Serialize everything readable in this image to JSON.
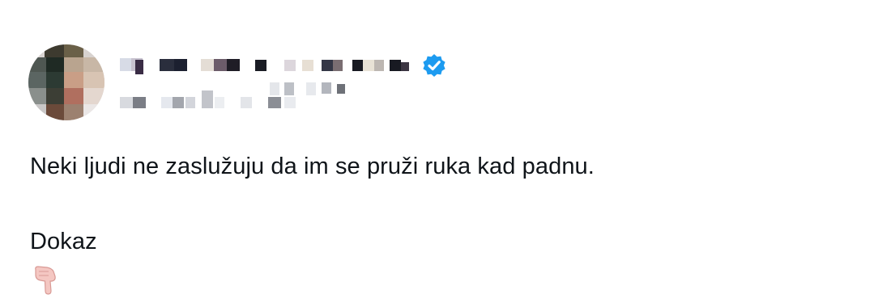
{
  "post": {
    "author": {
      "verified": true,
      "verified_badge_color": "#1d9bf0",
      "avatar_icon": "blurred-avatar",
      "name_redacted": true,
      "handle_redacted": true
    },
    "text_line_1": "Neki ljudi ne zaslužuju da im se pruži ruka kad padnu.",
    "text_line_2": "Dokaz",
    "emoji_icon": "backhand-index-pointing-down"
  }
}
